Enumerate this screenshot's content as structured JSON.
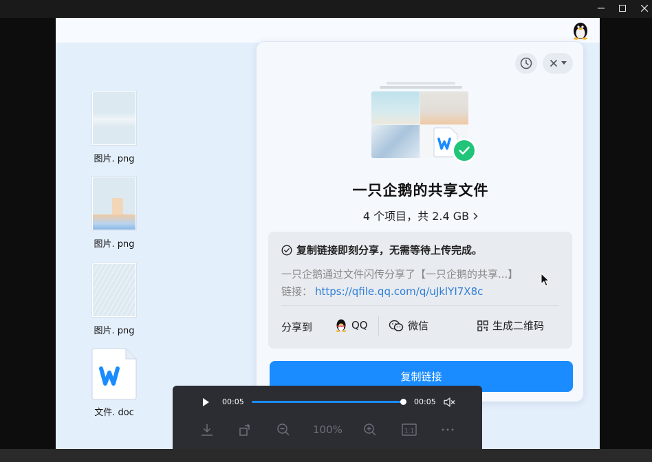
{
  "window": {
    "controls": [
      "minimize",
      "maximize",
      "close"
    ]
  },
  "desktop": {
    "files": [
      {
        "name": "图片. png",
        "icon": "sea-photo-thumbnail"
      },
      {
        "name": "图片. png",
        "icon": "desk-photo-thumbnail"
      },
      {
        "name": "图片. png",
        "icon": "building-photo-thumbnail"
      },
      {
        "name": "文件. doc",
        "icon": "word-doc-icon"
      }
    ]
  },
  "share_card": {
    "title": "一只企鹅的共享文件",
    "summary": "4 个项目，共 2.4 GB",
    "tip": "复制链接即刻分享，无需等待上传完成。",
    "message_line": "一只企鹅通过文件闪传分享了【一只企鹅的共享...】",
    "link_label": "链接：",
    "link_url": "https://qfile.qq.com/q/uJklYI7X8c",
    "share_to_label": "分享到",
    "share_options": {
      "qq": "QQ",
      "wechat": "微信",
      "qrcode": "生成二维码"
    },
    "copy_button": "复制链接",
    "accent_color": "#1a8cff",
    "success_color": "#20c57a"
  },
  "player": {
    "current_time": "00:05",
    "total_time": "00:05",
    "progress": 1.0,
    "zoom": "100%",
    "tools": [
      "download-icon",
      "rotate-icon",
      "zoom-out-icon",
      "zoom-in-icon",
      "actual-size-icon",
      "more-icon"
    ]
  }
}
